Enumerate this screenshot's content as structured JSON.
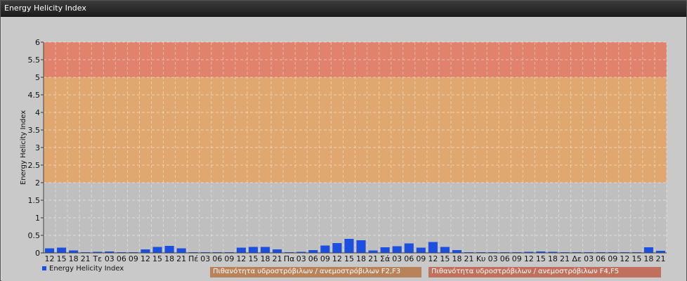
{
  "window": {
    "title": "Energy Helicity Index"
  },
  "legend": {
    "series_label": "Energy Helicity Index",
    "band1_label": "Πιθανότητα υδροστρόβιλων / ανεμοστρόβιλων F2,F3",
    "band2_label": "Πιθανότητα υδροστρόβιλων / ανεμοστρόβιλων F4,F5"
  },
  "colors": {
    "bar": "#1a4fe0",
    "band_low": "#bfbfbf",
    "band_mid": "#e0a870",
    "band_high": "#e0826c",
    "legend_mid": "#b8825a",
    "legend_high": "#c0705c"
  },
  "chart_data": {
    "type": "bar",
    "ylabel": "Energy Helicity Index",
    "ylim": [
      0,
      6
    ],
    "yticks": [
      "0",
      "0.5",
      "1",
      "1.5",
      "2",
      "2.5",
      "3",
      "3.5",
      "4",
      "4.5",
      "5",
      "5.5",
      "6"
    ],
    "grid": true,
    "bands": [
      {
        "from": 0,
        "to": 2,
        "color": "#bfbfbf"
      },
      {
        "from": 2,
        "to": 5,
        "color": "#e0a870"
      },
      {
        "from": 5,
        "to": 6,
        "color": "#e0826c"
      }
    ],
    "categories": [
      "12",
      "15",
      "18",
      "21",
      "Τε",
      "03",
      "06",
      "09",
      "12",
      "15",
      "18",
      "21",
      "Πέ",
      "03",
      "06",
      "09",
      "12",
      "15",
      "18",
      "21",
      "Πα",
      "03",
      "06",
      "09",
      "12",
      "15",
      "18",
      "21",
      "Σά",
      "03",
      "06",
      "09",
      "12",
      "15",
      "18",
      "21",
      "Κυ",
      "03",
      "06",
      "09",
      "12",
      "15",
      "18",
      "21",
      "Δε",
      "03",
      "06",
      "09",
      "12",
      "15",
      "18",
      "21"
    ],
    "values": [
      0.13,
      0.15,
      0.07,
      0.02,
      0.03,
      0.04,
      0.02,
      0.02,
      0.1,
      0.17,
      0.2,
      0.13,
      0.02,
      0.02,
      0.02,
      0.02,
      0.15,
      0.17,
      0.17,
      0.1,
      0.02,
      0.03,
      0.08,
      0.21,
      0.28,
      0.4,
      0.36,
      0.07,
      0.16,
      0.19,
      0.27,
      0.15,
      0.31,
      0.17,
      0.08,
      0.02,
      0.02,
      0.02,
      0.02,
      0.02,
      0.03,
      0.04,
      0.03,
      0.02,
      0.02,
      0.02,
      0.02,
      0.02,
      0.02,
      0.02,
      0.16,
      0.06
    ],
    "legend_position": "bottom"
  }
}
